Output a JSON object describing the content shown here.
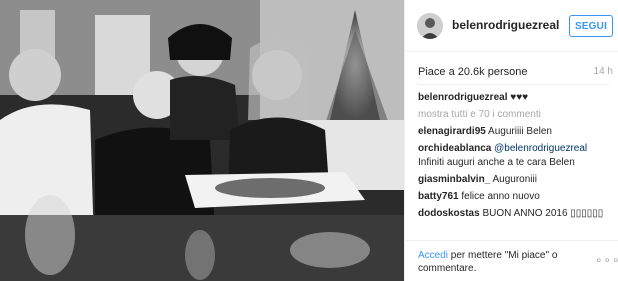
{
  "post": {
    "username": "belenrodriguezreal",
    "follow_label": "SEGUI",
    "likes": "Piace a 20.6k persone",
    "time_ago": "14 h",
    "caption_user": "belenrodriguezreal",
    "caption_text": "♥♥♥",
    "more_comments": "mostra tutti e 70 i commenti",
    "comments": [
      {
        "user": "elenagirardi95",
        "text": "Auguriiii Belen"
      },
      {
        "user": "orchideablanca",
        "mention": "@belenrodriguezreal",
        "text": "Infiniti auguri anche a te cara Belen"
      },
      {
        "user": "giasminbalvin_",
        "text": "Auguroniii"
      },
      {
        "user": "batty761",
        "text": "felice anno nuovo"
      },
      {
        "user": "dodoskostas",
        "text": "BUON ANNO 2016 ▯▯▯▯▯▯"
      }
    ],
    "login_link": "Accedi",
    "login_rest": " per mettere \"Mi piace\" o commentare.",
    "more_options": "∘∘∘"
  }
}
